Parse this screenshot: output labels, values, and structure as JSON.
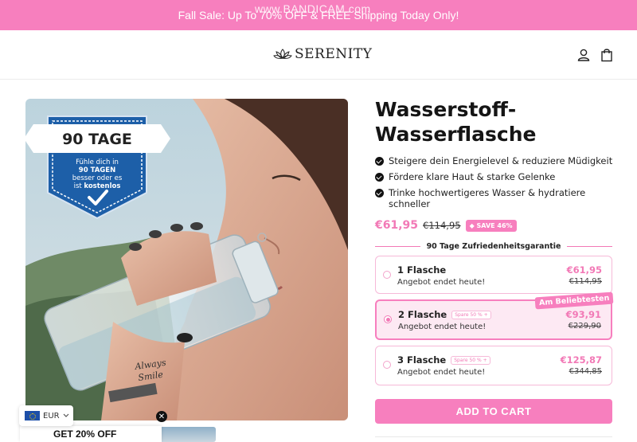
{
  "announcement": {
    "text": "Fall Sale: Up To 70% OFF & FREE Shipping Today Only!"
  },
  "watermark": "www.BANDICAM.com",
  "header": {
    "logo_text": "SERENITY"
  },
  "image_badge": {
    "title": "90 TAGE",
    "line1": "Fühle dich in",
    "line2": "90 TAGEN",
    "line3": "besser oder es",
    "line4": "ist",
    "line4_bold": "kostenlos"
  },
  "tattoo_text": [
    "Always",
    "Smile"
  ],
  "popup": {
    "text": "GET 20% OFF"
  },
  "currency": {
    "code": "EUR"
  },
  "product": {
    "title_line1": "Wasserstoff-",
    "title_line2": "Wasserflasche",
    "benefits": [
      "Steigere dein Energielevel & reduziere Müdigkeit",
      "Fördere klare Haut & starke Gelenke",
      "Trinke hochwertigeres Wasser & hydratiere schneller"
    ],
    "price": "€61,95",
    "compare_price": "€114,95",
    "save_badge": "SAVE 46%",
    "guarantee": "90 Tage Zufriedenheitsgarantie",
    "popular_label": "Am Beliebtesten",
    "options": [
      {
        "name": "1 Flasche",
        "tag": "",
        "subtitle": "Angebot endet heute!",
        "price": "€61,95",
        "old_price": "€114,95"
      },
      {
        "name": "2 Flasche",
        "tag": "Spare 50 % +",
        "subtitle": "Angebot endet heute!",
        "price": "€93,91",
        "old_price": "€229,90"
      },
      {
        "name": "3 Flasche",
        "tag": "Spare 50 % +",
        "subtitle": "Angebot endet heute!",
        "price": "€125,87",
        "old_price": "€344,85"
      }
    ],
    "selected_option": 1,
    "cta": "ADD TO CART"
  },
  "colors": {
    "brand_pink": "#f77fbe",
    "price_pink": "#f279b6",
    "badge_blue": "#1d5fa8"
  }
}
